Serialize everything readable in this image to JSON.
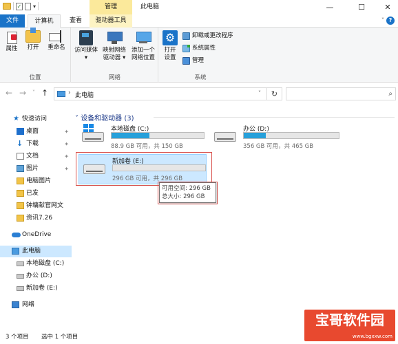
{
  "window": {
    "title": "此电脑",
    "context_tab_header": "管理",
    "minimize": "—",
    "maximize": "☐",
    "close": "✕"
  },
  "ribbon_tabs": [
    "文件",
    "计算机",
    "查看",
    "驱动器工具"
  ],
  "ribbon": {
    "location_group": {
      "label": "位置",
      "buttons": [
        "属性",
        "打开",
        "重命名"
      ]
    },
    "network_group": {
      "label": "网络",
      "access_media": [
        "访问媒体",
        "▾"
      ],
      "map_drive": [
        "映射网络",
        "驱动器 ▾"
      ],
      "add_location": [
        "添加一个",
        "网络位置"
      ]
    },
    "system_group": {
      "label": "系统",
      "open_settings": [
        "打开",
        "设置"
      ],
      "uninstall": "卸载或更改程序",
      "system_properties": "系统属性",
      "manage": "管理"
    }
  },
  "address_bar": {
    "path_item": "此电脑",
    "separator": "›"
  },
  "sidebar": {
    "items": [
      {
        "label": "快速访问",
        "icon": "star-icon"
      },
      {
        "label": "桌面",
        "icon": "desktop-icon",
        "pinned": true
      },
      {
        "label": "下载",
        "icon": "download-icon",
        "pinned": true
      },
      {
        "label": "文档",
        "icon": "document-icon",
        "pinned": true
      },
      {
        "label": "图片",
        "icon": "pictures-icon",
        "pinned": true
      },
      {
        "label": "电脑图片",
        "icon": "folder-icon"
      },
      {
        "label": "已发",
        "icon": "folder-icon"
      },
      {
        "label": "钟墉献官网文",
        "icon": "folder-icon"
      },
      {
        "label": "资讯7.26",
        "icon": "folder-icon"
      },
      {
        "label": "OneDrive",
        "icon": "onedrive-icon"
      },
      {
        "label": "此电脑",
        "icon": "this-pc-icon",
        "selected": true
      },
      {
        "label": "本地磁盘 (C:)",
        "icon": "drive-icon"
      },
      {
        "label": "办公 (D:)",
        "icon": "drive-icon"
      },
      {
        "label": "新加卷 (E:)",
        "icon": "drive-icon"
      },
      {
        "label": "网络",
        "icon": "network-icon"
      }
    ]
  },
  "content": {
    "section_title": "设备和驱动器 (3)",
    "drives": [
      {
        "name": "本地磁盘 (C:)",
        "info": "88.9 GB 可用，共 150 GB",
        "used_fraction": 0.41,
        "system": true
      },
      {
        "name": "办公 (D:)",
        "info": "356 GB 可用，共 465 GB",
        "used_fraction": 0.23,
        "system": false
      },
      {
        "name": "新加卷 (E:)",
        "info": "296 GB 可用，共 296 GB",
        "used_fraction": 0.0,
        "system": false,
        "selected": true
      }
    ],
    "tooltip": {
      "line1": "可用空间: 296 GB",
      "line2": "总大小: 296 GB"
    }
  },
  "status": {
    "count": "3 个项目",
    "selected": "选中 1 个项目"
  },
  "watermark": {
    "text": "宝哥软件园",
    "url": "www.bgxxw.com"
  },
  "colors": {
    "accent": "#1a73c8",
    "context_tab": "#fbe99b",
    "selection": "#cce8ff",
    "drive_fill": "#26a0da",
    "highlight_frame": "#d9534f"
  }
}
